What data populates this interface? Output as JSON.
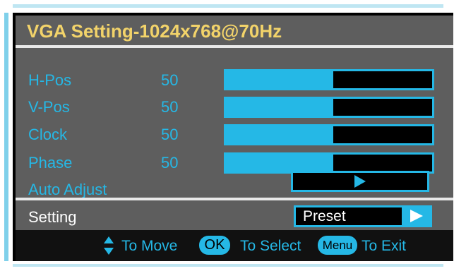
{
  "title": "VGA Setting-1024x768@70Hz",
  "adjustments": [
    {
      "label": "H-Pos",
      "value": "50",
      "level": 0.52
    },
    {
      "label": "V-Pos",
      "value": "50",
      "level": 0.52
    },
    {
      "label": "Clock",
      "value": "50",
      "level": 0.52
    },
    {
      "label": "Phase",
      "value": "50",
      "level": 0.52
    }
  ],
  "auto_adjust": {
    "label": "Auto Adjust",
    "icon": "play-icon"
  },
  "setting": {
    "label": "Setting",
    "value": "Preset",
    "icon": "arrow-right-icon"
  },
  "footer": {
    "move_label": "To Move",
    "ok_key": "OK",
    "select_label": "To Select",
    "menu_key": "Menu",
    "exit_label": "To Exit"
  },
  "colors": {
    "accent": "#25b8e6",
    "title": "#f2d36a",
    "panel": "#5e5e5e",
    "background": "#000000"
  }
}
